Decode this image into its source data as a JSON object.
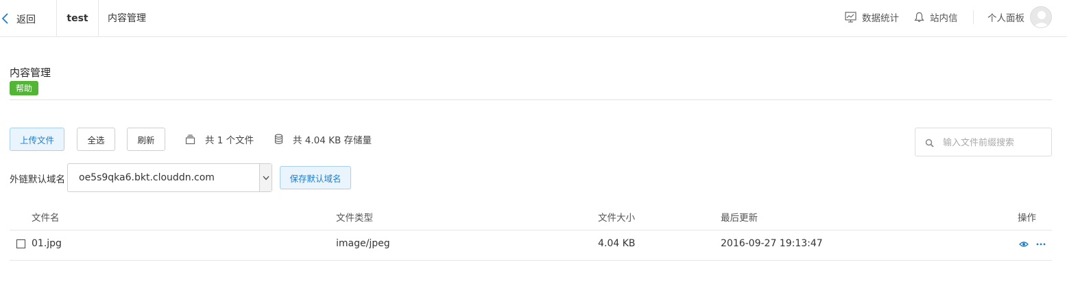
{
  "nav": {
    "back_label": "返回",
    "bucket_name": "test",
    "breadcrumb": "内容管理",
    "stats_label": "数据统计",
    "messages_label": "站内信",
    "profile_label": "个人面板"
  },
  "page": {
    "title": "内容管理",
    "help_badge": "帮助"
  },
  "toolbar": {
    "upload_label": "上传文件",
    "select_all_label": "全选",
    "refresh_label": "刷新",
    "file_count_text": "共 1 个文件",
    "storage_text": "共 4.04 KB 存储量",
    "search_placeholder": "输入文件前缀搜索"
  },
  "domain": {
    "label": "外链默认域名",
    "selected": "oe5s9qka6.bkt.clouddn.com",
    "save_label": "保存默认域名"
  },
  "table": {
    "columns": [
      "文件名",
      "文件类型",
      "文件大小",
      "最后更新",
      "操作"
    ],
    "rows": [
      {
        "name": "01.jpg",
        "type": "image/jpeg",
        "size": "4.04 KB",
        "updated": "2016-09-27 19:13:47"
      }
    ]
  },
  "colors": {
    "accent": "#1f7ccd",
    "help_green": "#52b535",
    "border": "#e6e6e6"
  },
  "icons": {
    "back": "chevron-left-icon",
    "stats": "chart-icon",
    "messages": "bell-icon",
    "files": "stack-icon",
    "storage": "database-icon",
    "search": "search-icon",
    "preview": "eye-icon",
    "more": "ellipsis-icon"
  }
}
